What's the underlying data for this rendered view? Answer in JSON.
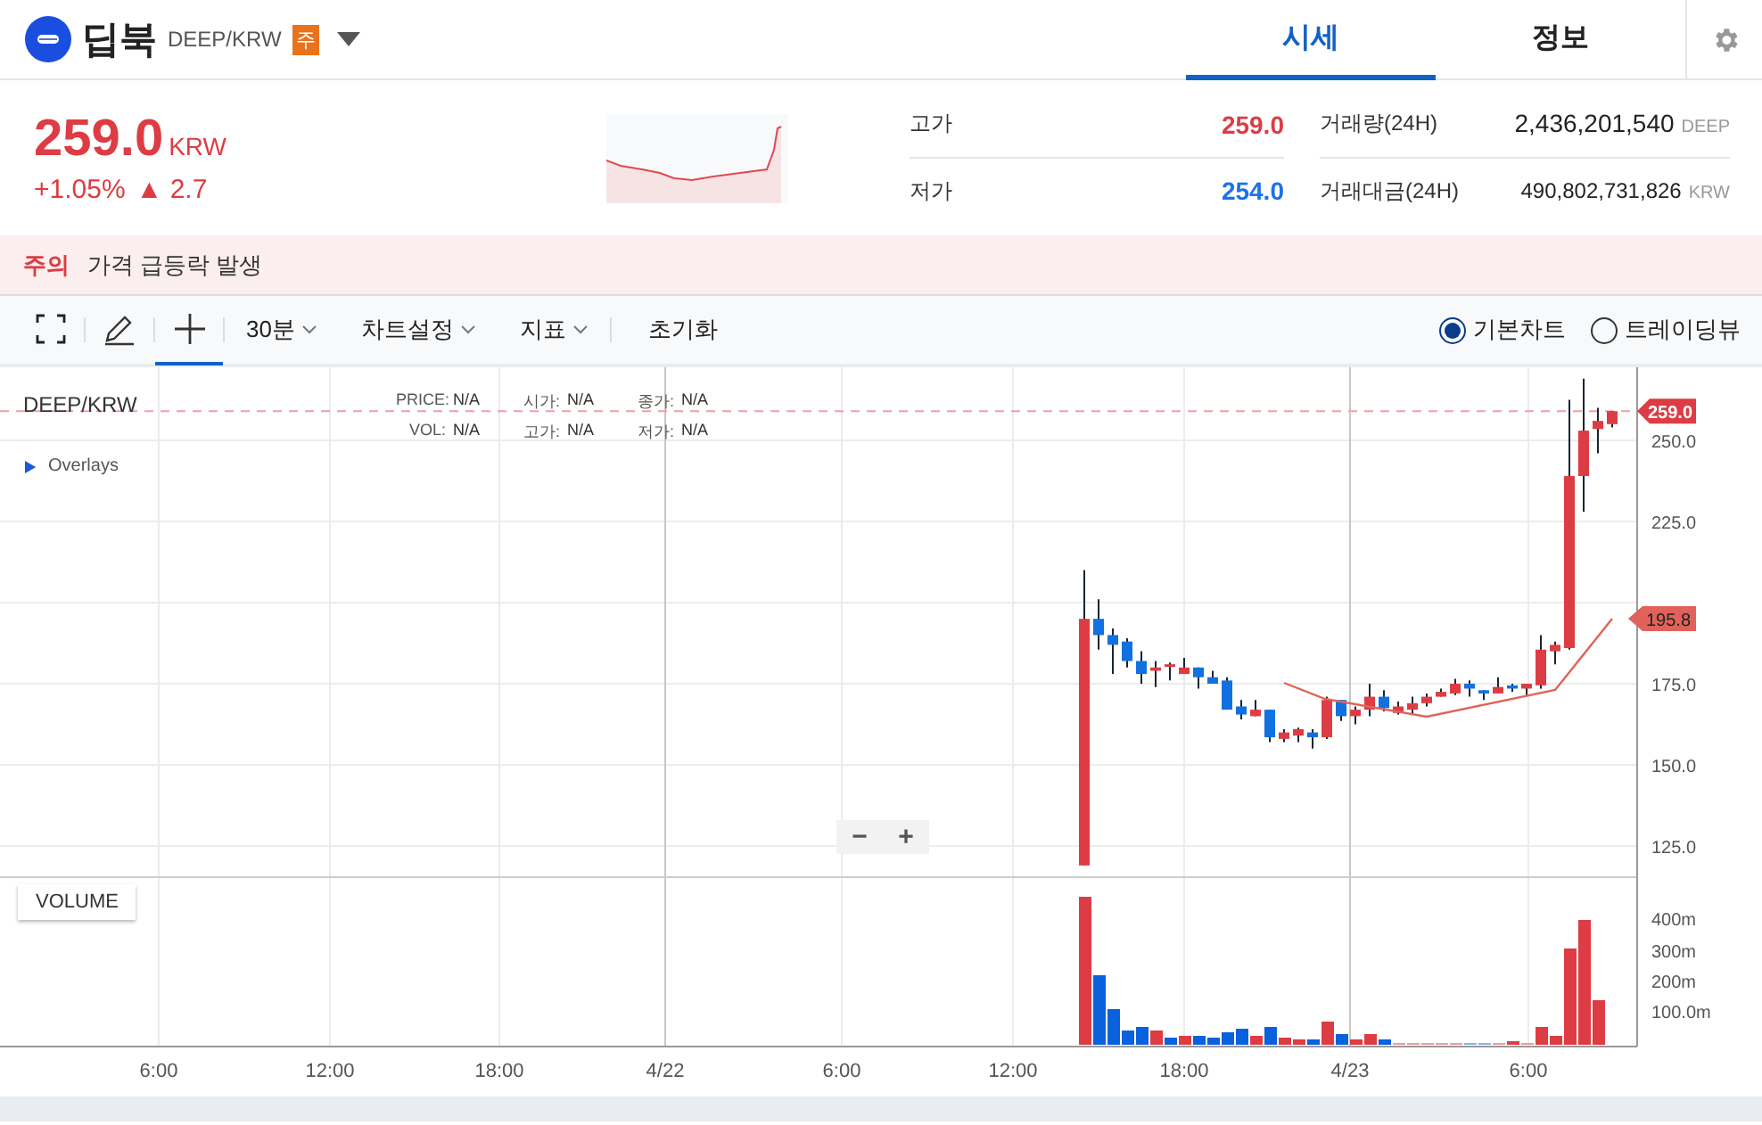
{
  "header": {
    "coin_name": "딥북",
    "market": "DEEP/KRW",
    "badge": "주",
    "tabs": [
      {
        "label": "시세",
        "selected": true
      },
      {
        "label": "정보",
        "selected": false
      }
    ]
  },
  "price": {
    "value": "259.0",
    "unit": "KRW",
    "change_rate": "+1.05%",
    "change_arrow": "▲",
    "change_amount": "2.7"
  },
  "range_stats": [
    {
      "label": "고가",
      "value": "259.0",
      "kind": "high"
    },
    {
      "label": "저가",
      "value": "254.0",
      "kind": "low"
    }
  ],
  "volume_stats": [
    {
      "label": "거래량(24H)",
      "value": "2,436,201,540",
      "unit": "DEEP"
    },
    {
      "label": "거래대금(24H)",
      "value": "490,802,731,826",
      "unit": "KRW"
    }
  ],
  "notice": {
    "label": "주의",
    "text": "가격 급등락 발생"
  },
  "toolbar": {
    "tools": [
      {
        "kind": "fullscreen",
        "selected": false
      },
      {
        "kind": "pencil",
        "selected": false
      },
      {
        "kind": "crosshair",
        "selected": true
      }
    ],
    "dropdowns": [
      "30분",
      "차트설정",
      "지표"
    ],
    "reset": "초기화",
    "views": [
      {
        "label": "기본차트",
        "selected": true
      },
      {
        "label": "트레이딩뷰",
        "selected": false
      }
    ]
  },
  "chart": {
    "symbol": "DEEP/KRW",
    "legend": [
      {
        "label": "PRICE:",
        "value": "N/A"
      },
      {
        "label": "시가:",
        "value": "N/A"
      },
      {
        "label": "종가:",
        "value": "N/A"
      },
      {
        "label": "VOL:",
        "value": "N/A"
      },
      {
        "label": "고가:",
        "value": "N/A"
      },
      {
        "label": "저가:",
        "value": "N/A"
      }
    ],
    "overlays": {
      "label": "Overlays",
      "expanded": false
    },
    "zoom_out": "−",
    "zoom_in": "+",
    "price_labels": [
      "250.0",
      "225.0",
      "175.0",
      "150.0",
      "125.0"
    ],
    "last_price_tag": "259.0",
    "ma_tag": "195.8",
    "volume_label": "VOLUME",
    "volume_labels": [
      "400m",
      "300m",
      "200m",
      "100.0m"
    ],
    "time_labels": [
      "6:00",
      "12:00",
      "18:00",
      "4/22",
      "6:00",
      "12:00",
      "18:00",
      "4/23",
      "6:00"
    ]
  }
}
